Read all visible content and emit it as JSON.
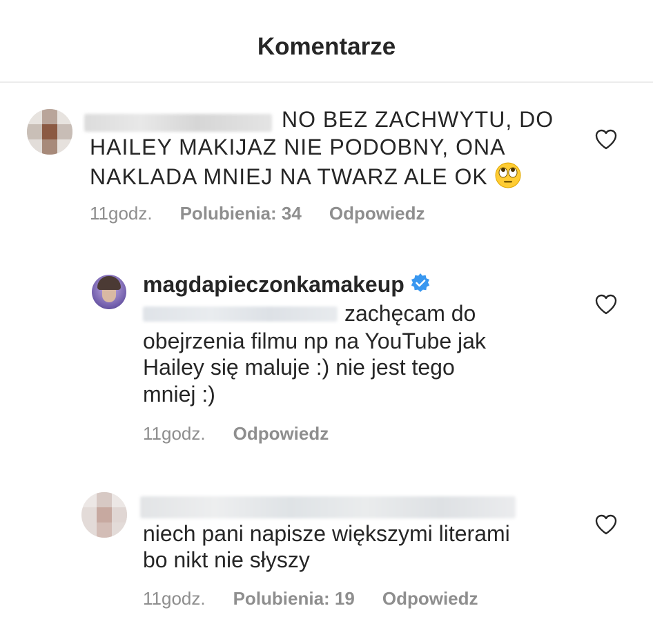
{
  "header": {
    "title": "Komentarze"
  },
  "comments": [
    {
      "text_lines": [
        "NO BEZ ZACHWYTU, DO",
        "HAILEY MAKIJAZ NIE PODOBNY, ONA",
        "NAKLADA MNIEJ NA TWARZ ALE OK"
      ],
      "emoji_icon": "face-with-rolling-eyes-icon",
      "time": "11godz.",
      "likes": "Polubienia: 34",
      "reply": "Odpowiedz"
    },
    {
      "username": "magdapieczonkamakeup",
      "verified_icon": "verified-badge-icon",
      "text_lines": [
        "zachęcam do",
        "obejrzenia filmu np na YouTube jak",
        "Hailey się maluje :) nie jest tego",
        "mniej :)"
      ],
      "time": "11godz.",
      "reply": "Odpowiedz"
    },
    {
      "text_lines": [
        "niech pani napisze większymi literami",
        "bo nikt nie słyszy"
      ],
      "time": "11godz.",
      "likes": "Polubienia: 19",
      "reply": "Odpowiedz"
    }
  ],
  "colors": {
    "text": "#262626",
    "meta": "#8e8e8e",
    "verified": "#3897f0",
    "divider": "#ececec"
  }
}
